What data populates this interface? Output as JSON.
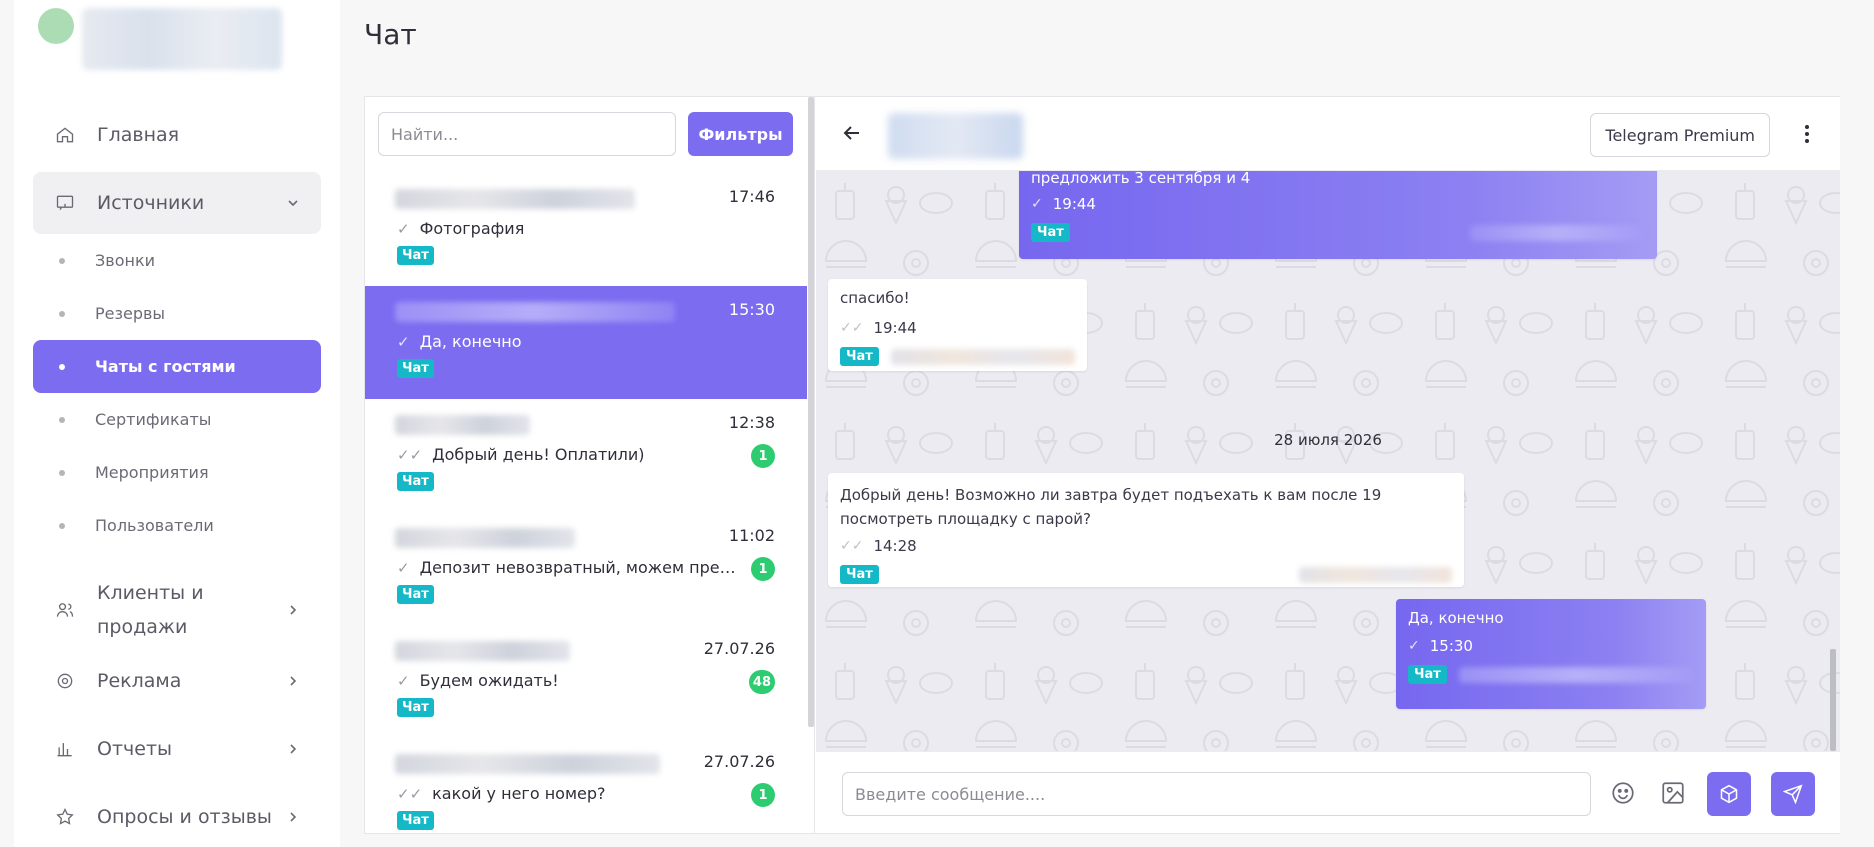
{
  "page": {
    "title": "Чат"
  },
  "sidebar": {
    "logo_icon": "logo-icon",
    "nav": [
      {
        "id": "home",
        "label": "Главная",
        "icon": "home-icon"
      },
      {
        "id": "sources",
        "label": "Источники",
        "icon": "monitor-icon",
        "expanded": true,
        "children": [
          {
            "label": "Звонки"
          },
          {
            "label": "Резервы"
          },
          {
            "label": "Чаты с гостями",
            "active": true
          },
          {
            "label": "Сертификаты"
          },
          {
            "label": "Мероприятия"
          },
          {
            "label": "Пользователи"
          }
        ]
      },
      {
        "id": "clients",
        "label": "Клиенты и продажи",
        "icon": "users-icon"
      },
      {
        "id": "ads",
        "label": "Реклама",
        "icon": "target-icon"
      },
      {
        "id": "reports",
        "label": "Отчеты",
        "icon": "bar-chart-icon"
      },
      {
        "id": "surveys",
        "label": "Опросы и отзывы",
        "icon": "star-icon"
      }
    ]
  },
  "chat_list": {
    "search_placeholder": "Найти...",
    "filters_label": "Фильтры",
    "items": [
      {
        "time": "17:46",
        "last_message": "Фотография",
        "check": "✓",
        "tag": "Чат",
        "unread": ""
      },
      {
        "time": "15:30",
        "last_message": "Да, конечно",
        "check": "✓",
        "tag": "Чат",
        "unread": "",
        "active": true
      },
      {
        "time": "12:38",
        "last_message": "Добрый день! Оплатили)",
        "check": "✓✓",
        "tag": "Чат",
        "unread": "1"
      },
      {
        "time": "11:02",
        "last_message": "Депозит невозвратный, можем предложить",
        "check": "✓",
        "tag": "Чат",
        "unread": "1"
      },
      {
        "time": "27.07.26",
        "last_message": "Будем ожидать!",
        "check": "✓",
        "tag": "Чат",
        "unread": "48"
      },
      {
        "time": "27.07.26",
        "last_message": "какой у него номер?",
        "check": "✓✓",
        "tag": "Чат",
        "unread": "1"
      }
    ]
  },
  "conversation": {
    "source_label": "Telegram Premium",
    "date_separator": "28 июля 2026",
    "messages": [
      {
        "direction": "out",
        "text": "предложить 3 сентября и 4",
        "time": "19:44",
        "tag": "Чат"
      },
      {
        "direction": "in",
        "text": "спасибо!",
        "time": "19:44",
        "tag": "Чат"
      },
      {
        "direction": "in",
        "text": "Добрый день! Возможно ли завтра будет подъехать к вам после 19 посмотреть площадку с парой?",
        "time": "14:28",
        "tag": "Чат"
      },
      {
        "direction": "out",
        "text": "Да, конечно",
        "time": "15:30",
        "tag": "Чат"
      }
    ],
    "composer_placeholder": "Введите сообщение...."
  },
  "colors": {
    "accent": "#7b6cf0",
    "tag": "#14b8c6",
    "badge": "#2ecc71"
  }
}
